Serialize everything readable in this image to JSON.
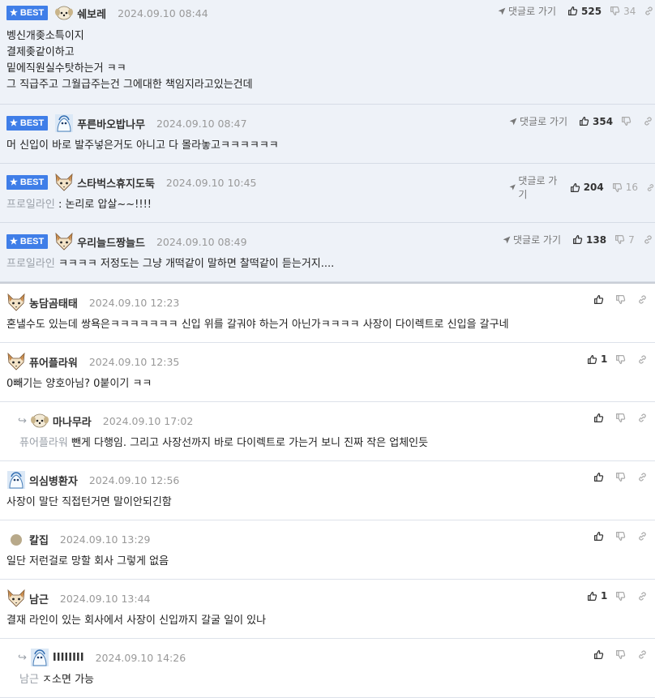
{
  "best_label": "BEST",
  "goto_label": "댓글로 가기",
  "best": [
    {
      "nick": "쉐보레",
      "avatar": "puppy-avatar",
      "date": "2024.09.10 08:44",
      "up": "525",
      "down": "34",
      "lines": [
        "벵신개좆소특이지",
        "결제좆같이하고",
        "밑에직원실수탓하는거 ㅋㅋ",
        "그 직급주고 그월급주는건 그에대한 책임지라고있는건데"
      ]
    },
    {
      "nick": "푸른바오밥나무",
      "avatar": "blue-creature-avatar",
      "date": "2024.09.10 08:47",
      "up": "354",
      "down": "",
      "lines": [
        "머 신입이 바로 발주넣은거도 아니고 다 몰라놓고ㅋㅋㅋㅋㅋㅋ"
      ]
    },
    {
      "nick": "스타벅스휴지도둑",
      "avatar": "fox-avatar",
      "date": "2024.09.10 10:45",
      "up": "204",
      "down": "16",
      "quote": "프로일라인",
      "text": " : 논리로 압살~~!!!!"
    },
    {
      "nick": "우리늘드짱늘드",
      "avatar": "fox-avatar",
      "date": "2024.09.10 08:49",
      "up": "138",
      "down": "7",
      "quote": "프로일라인",
      "text": " ㅋㅋㅋㅋ 저정도는 그냥 개떡같이 말하면 찰떡같이 듣는거지...."
    }
  ],
  "comments": [
    {
      "nick": "농담곰태태",
      "avatar": "fox-avatar",
      "date": "2024.09.10 12:23",
      "up": "",
      "reply": false,
      "text": "혼낼수도 있는데 쌍욕은ㅋㅋㅋㅋㅋㅋㅋ 신입 위를 갈궈야 하는거 아닌가ㅋㅋㅋㅋ 사장이 다이렉트로 신입을 갈구네"
    },
    {
      "nick": "퓨어플라워",
      "avatar": "fox-avatar",
      "date": "2024.09.10 12:35",
      "up": "1",
      "reply": false,
      "text": "0빼기는 양호아님? 0붙이기 ㅋㅋ"
    },
    {
      "nick": "마나무라",
      "avatar": "puppy-avatar",
      "date": "2024.09.10 17:02",
      "up": "",
      "reply": true,
      "quote": "퓨어플라워",
      "text": " 뺀게 다행임. 그리고 사장선까지 바로 다이렉트로 가는거 보니 진짜 작은 업체인듯"
    },
    {
      "nick": "의심병환자",
      "avatar": "blue-creature-avatar",
      "date": "2024.09.10 12:56",
      "up": "",
      "reply": false,
      "text": "사장이 말단 직접턴거면 말이안되긴함"
    },
    {
      "nick": "칼집",
      "avatar": "dot-avatar",
      "date": "2024.09.10 13:29",
      "up": "",
      "reply": false,
      "text": "일단 저런걸로 망할 회사 그렇게 없음"
    },
    {
      "nick": "남근",
      "avatar": "fox-avatar",
      "date": "2024.09.10 13:44",
      "up": "1",
      "reply": false,
      "text": "결재 라인이 있는 회사에서 사장이 신입까지 갈굴 일이 있나"
    },
    {
      "nick": "IIIIIIII",
      "avatar": "blue-creature-avatar",
      "date": "2024.09.10 14:26",
      "up": "",
      "reply": true,
      "quote": "남근",
      "text": " ㅈ소면 가능"
    }
  ]
}
